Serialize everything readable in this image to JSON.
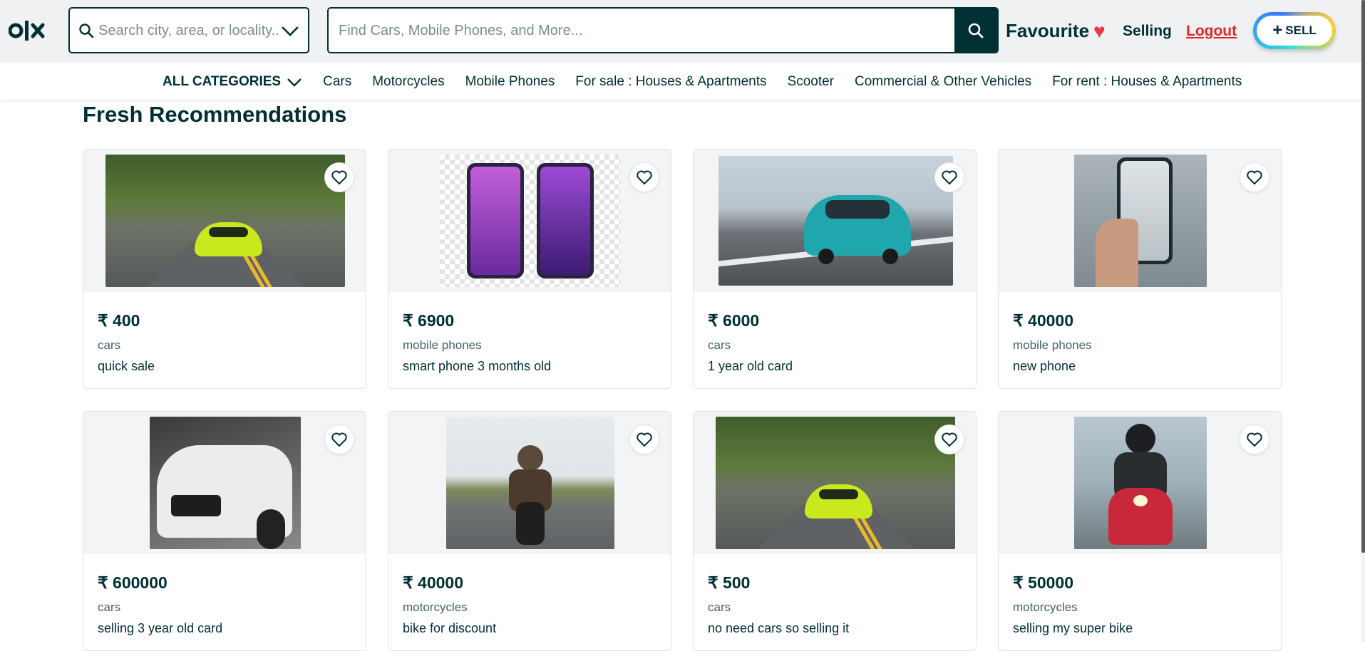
{
  "header": {
    "logo_icon": "olx-logo",
    "location_placeholder": "Search city, area, or locality...",
    "search_placeholder": "Find Cars, Mobile Phones, and More...",
    "favourite_label": "Favourite",
    "selling_label": "Selling",
    "logout_label": "Logout",
    "sell_label": "SELL"
  },
  "categories": {
    "all_label": "ALL CATEGORIES",
    "items": [
      "Cars",
      "Motorcycles",
      "Mobile Phones",
      "For sale : Houses & Apartments",
      "Scooter",
      "Commercial & Other Vehicles",
      "For rent : Houses & Apartments"
    ]
  },
  "section_title": "Fresh Recommendations",
  "listings": [
    {
      "price": "₹ 400",
      "category": "cars",
      "title": "quick sale",
      "image": "lime-sports-car-road"
    },
    {
      "price": "₹ 6900",
      "category": "mobile phones",
      "title": "smart phone 3 months old",
      "image": "purple-smartphones"
    },
    {
      "price": "₹ 6000",
      "category": "cars",
      "title": "1 year old card",
      "image": "teal-hatchback-car"
    },
    {
      "price": "₹ 40000",
      "category": "mobile phones",
      "title": "new phone",
      "image": "hand-holding-phone"
    },
    {
      "price": "₹ 600000",
      "category": "cars",
      "title": "selling 3 year old card",
      "image": "white-supercar"
    },
    {
      "price": "₹ 40000",
      "category": "motorcycles",
      "title": "bike for discount",
      "image": "rider-on-motorcycle"
    },
    {
      "price": "₹ 500",
      "category": "cars",
      "title": "no need cars so selling it",
      "image": "lime-sports-car-road"
    },
    {
      "price": "₹ 50000",
      "category": "motorcycles",
      "title": "selling my super bike",
      "image": "red-sport-bike-rider"
    }
  ],
  "colors": {
    "brand_dark": "#002f34",
    "header_bg": "#eff1f3",
    "heart": "#e63946",
    "logout": "#e02828"
  }
}
